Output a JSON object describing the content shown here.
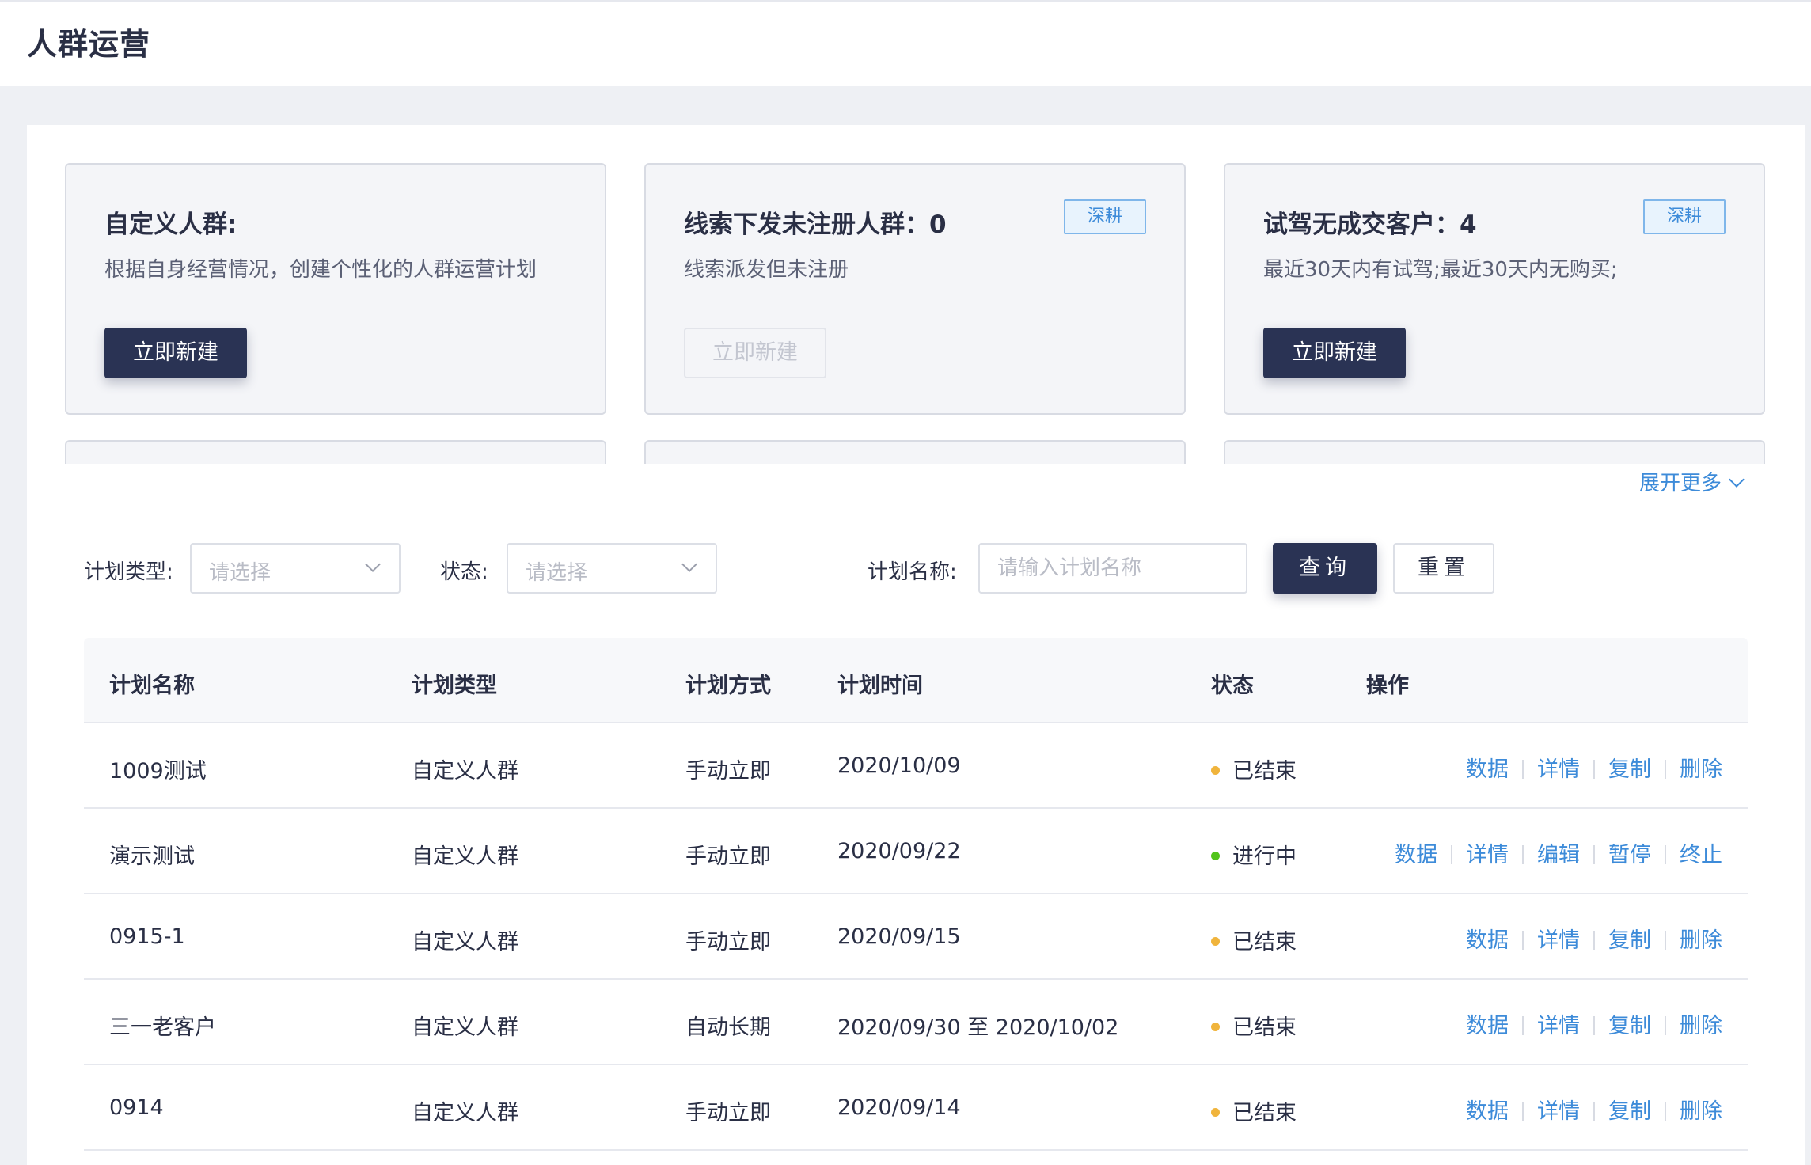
{
  "page": {
    "title": "人群运营"
  },
  "cards": [
    {
      "title": "自定义人群:",
      "desc": "根据自身经营情况，创建个性化的人群运营计划",
      "tag": "",
      "button": "立即新建",
      "button_disabled": false
    },
    {
      "title": "线索下发未注册人群：0",
      "desc": "线索派发但未注册",
      "tag": "深耕",
      "button": "立即新建",
      "button_disabled": true
    },
    {
      "title": "试驾无成交客户：4",
      "desc": "最近30天内有试驾;最近30天内无购买;",
      "tag": "深耕",
      "button": "立即新建",
      "button_disabled": false
    }
  ],
  "expand_more": "展开更多",
  "filters": {
    "plan_type_label": "计划类型:",
    "plan_type_placeholder": "请选择",
    "status_label": "状态:",
    "status_placeholder": "请选择",
    "plan_name_label": "计划名称:",
    "plan_name_placeholder": "请输入计划名称",
    "query_button": "查询",
    "reset_button": "重置"
  },
  "table": {
    "headers": [
      "计划名称",
      "计划类型",
      "计划方式",
      "计划时间",
      "状态",
      "操作"
    ],
    "rows": [
      {
        "name": "1009测试",
        "type": "自定义人群",
        "method": "手动立即",
        "time": "2020/10/09",
        "status": "已结束",
        "status_color": "#f0b43c",
        "ops": [
          "数据",
          "详情",
          "复制",
          "删除"
        ]
      },
      {
        "name": "演示测试",
        "type": "自定义人群",
        "method": "手动立即",
        "time": "2020/09/22",
        "status": "进行中",
        "status_color": "#52c41a",
        "ops": [
          "数据",
          "详情",
          "编辑",
          "暂停",
          "终止"
        ]
      },
      {
        "name": "0915-1",
        "type": "自定义人群",
        "method": "手动立即",
        "time": "2020/09/15",
        "status": "已结束",
        "status_color": "#f0b43c",
        "ops": [
          "数据",
          "详情",
          "复制",
          "删除"
        ]
      },
      {
        "name": "三一老客户",
        "type": "自定义人群",
        "method": "自动长期",
        "time": "2020/09/30 至 2020/10/02",
        "status": "已结束",
        "status_color": "#f0b43c",
        "ops": [
          "数据",
          "详情",
          "复制",
          "删除"
        ]
      },
      {
        "name": "0914",
        "type": "自定义人群",
        "method": "手动立即",
        "time": "2020/09/14",
        "status": "已结束",
        "status_color": "#f0b43c",
        "ops": [
          "数据",
          "详情",
          "复制",
          "删除"
        ]
      }
    ]
  }
}
